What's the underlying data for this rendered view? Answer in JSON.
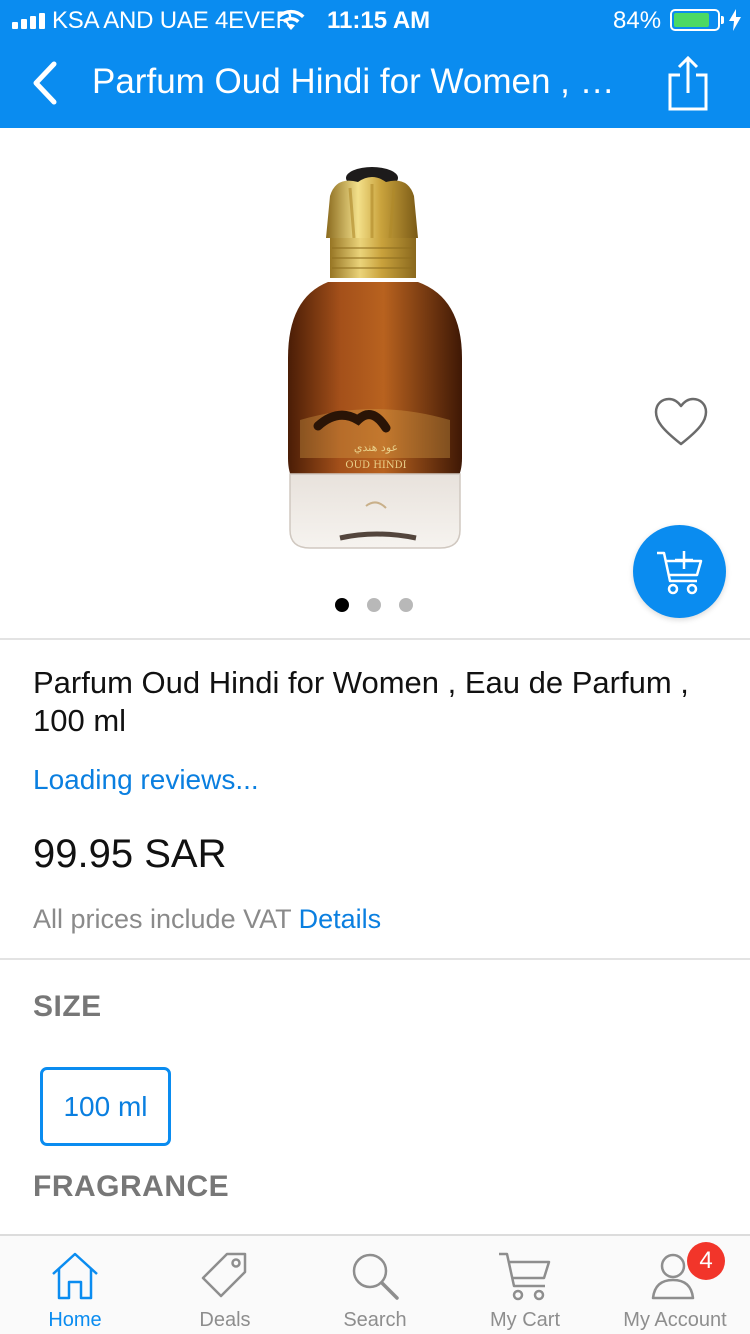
{
  "status_bar": {
    "carrier": "KSA AND UAE 4EVER",
    "time": "11:15 AM",
    "battery_percent": "84%",
    "battery_level": 0.84
  },
  "nav": {
    "title": "Parfum Oud Hindi for Women , Eau de Parfum , 100 ml",
    "back_icon": "chevron-left-icon",
    "share_icon": "share-icon"
  },
  "gallery": {
    "image_count": 3,
    "active_index": 0,
    "bottle_label_ar": "عود هندي",
    "bottle_label_en": "OUD HINDI"
  },
  "product": {
    "name": "Parfum Oud Hindi for Women , Eau de Parfum , 100 ml",
    "reviews_text": "Loading reviews...",
    "price": "99.95 SAR",
    "vat_text": "All prices include VAT",
    "vat_link": "Details"
  },
  "sections": {
    "size_title": "SIZE",
    "size_selected": "100 ml",
    "fragrance_title": "FRAGRANCE"
  },
  "tabbar": {
    "tabs": [
      {
        "label": "Home",
        "icon": "home-icon"
      },
      {
        "label": "Deals",
        "icon": "tag-icon"
      },
      {
        "label": "Search",
        "icon": "search-icon"
      },
      {
        "label": "My Cart",
        "icon": "cart-icon"
      },
      {
        "label": "My Account",
        "icon": "user-icon",
        "badge": "4"
      }
    ]
  },
  "colors": {
    "accent": "#0a8cf0",
    "badge": "#f2352a",
    "battery": "#4cd964"
  }
}
